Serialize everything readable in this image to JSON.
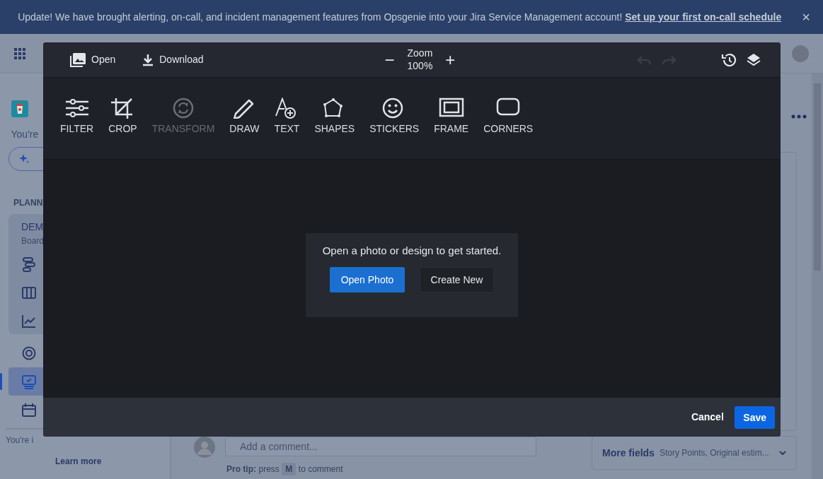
{
  "banner": {
    "text": "Update! We have brought alerting, on-call, and incident management features from Opsgenie into your Jira Service Management account!",
    "link": "Set up your first on-call schedule",
    "close": "×"
  },
  "sidebar": {
    "notice": "You're",
    "section": "PLANN",
    "project": {
      "name": "DEM",
      "subtitle": "Board"
    },
    "project_items": [
      {
        "kind": "timeline",
        "selected": false
      },
      {
        "kind": "board",
        "selected": false
      },
      {
        "kind": "reports",
        "selected": false
      }
    ],
    "items": [
      {
        "kind": "target",
        "selected": false
      },
      {
        "kind": "monitor",
        "selected": true
      },
      {
        "kind": "calendar",
        "selected": false
      }
    ],
    "footer_text": "You're i",
    "footer_link": "Learn more"
  },
  "comment": {
    "placeholder": "Add a comment...",
    "tip_label": "Pro tip:",
    "tip_before": "press",
    "key": "M",
    "tip_after": "to comment"
  },
  "more_fields": {
    "label": "More fields",
    "summary": "Story Points, Original estim..."
  },
  "editor": {
    "open": "Open",
    "download": "Download",
    "zoom_label": "Zoom",
    "zoom_value": "100%",
    "zoom_out": "−",
    "zoom_in": "+",
    "history": [
      {
        "kind": "undo",
        "disabled": true
      },
      {
        "kind": "redo",
        "disabled": true
      }
    ],
    "tools": [
      {
        "kind": "filter",
        "label": "FILTER",
        "disabled": false
      },
      {
        "kind": "crop",
        "label": "CROP",
        "disabled": false
      },
      {
        "kind": "transform",
        "label": "TRANSFORM",
        "disabled": true
      },
      {
        "kind": "draw",
        "label": "DRAW",
        "disabled": false
      },
      {
        "kind": "text",
        "label": "TEXT",
        "disabled": false
      },
      {
        "kind": "shapes",
        "label": "SHAPES",
        "disabled": false
      },
      {
        "kind": "stickers",
        "label": "STICKERS",
        "disabled": false
      },
      {
        "kind": "frame",
        "label": "FRAME",
        "disabled": false
      },
      {
        "kind": "corners",
        "label": "CORNERS",
        "disabled": false
      }
    ],
    "prompt": "Open a photo or design to get started.",
    "open_photo": "Open Photo",
    "create_new": "Create New",
    "cancel": "Cancel",
    "save": "Save"
  }
}
